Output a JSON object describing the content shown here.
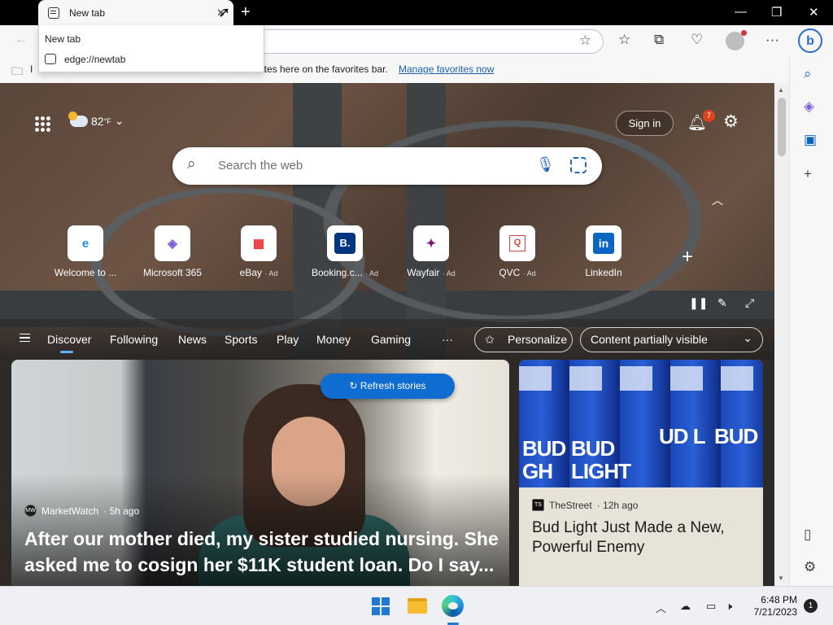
{
  "browser": {
    "tab_title": "New tab",
    "tab_close": "✕",
    "new_tab_button": "+",
    "window_controls": {
      "minimize": "—",
      "maximize": "❐",
      "close": "✕"
    },
    "tab_dropdown": {
      "title": "New tab",
      "url": "edge://newtab"
    },
    "favorites_bar": {
      "text": "ites here on the favorites bar.",
      "partial_prefix": "I",
      "link": "Manage favorites now"
    }
  },
  "newtab": {
    "weather": {
      "temp": "82",
      "unit": "°F"
    },
    "sign_in": "Sign in",
    "notification_count": "7",
    "search_placeholder": "Search the web",
    "quick_links": [
      {
        "label": "Welcome to ...",
        "ad": "",
        "icon": "edge-icon",
        "color": "#1b8de0"
      },
      {
        "label": "Microsoft 365",
        "ad": "",
        "icon": "m365-icon",
        "color": "#7b5fd6"
      },
      {
        "label": "eBay",
        "ad": "· Ad",
        "icon": "ebay-icon",
        "color": "#e53238"
      },
      {
        "label": "Booking.c...",
        "ad": "· Ad",
        "icon": "booking-icon",
        "color": "#003580"
      },
      {
        "label": "Wayfair",
        "ad": "· Ad",
        "icon": "wayfair-icon",
        "color": "#7f187f"
      },
      {
        "label": "QVC",
        "ad": "· Ad",
        "icon": "qvc-icon",
        "color": "#d8423b"
      },
      {
        "label": "LinkedIn",
        "ad": "",
        "icon": "linkedin-icon",
        "color": "#0a66c2"
      }
    ],
    "nav_tabs": [
      "Discover",
      "Following",
      "News",
      "Sports",
      "Play",
      "Money",
      "Gaming"
    ],
    "more": "···",
    "personalize": "Personalize",
    "content_visibility": "Content partially visible"
  },
  "feed": {
    "refresh_button": "Refresh stories",
    "story1": {
      "source": "MarketWatch",
      "age": "· 5h ago",
      "logo": "MW",
      "headline": "After our mother died, my sister studied nursing. She asked me to cosign her $11K student loan. Do I say..."
    },
    "story2": {
      "source": "TheStreet",
      "age": "· 12h ago",
      "logo": "TS",
      "headline": "Bud Light Just Made a New, Powerful Enemy"
    }
  },
  "taskbar": {
    "time": "6:48 PM",
    "date": "7/21/2023",
    "notifications": "1"
  },
  "colors": {
    "accent": "#0f6cd0",
    "link": "#1a5fb4",
    "badge": "#e0421b"
  }
}
